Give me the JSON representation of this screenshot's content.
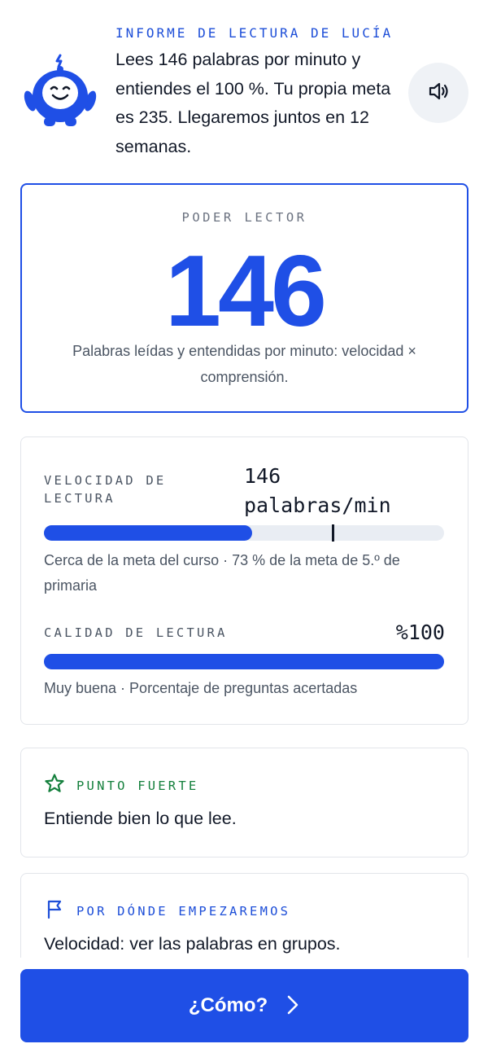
{
  "header": {
    "eyebrow": "INFORME DE LECTURA DE LUCÍA",
    "message": "Lees 146 palabras por minuto y entiendes el 100 %. Tu propia meta es 235. Llegaremos juntos en 12 semanas.",
    "mascot_icon": "robot-mascot-icon",
    "sound_icon": "speaker-icon"
  },
  "power": {
    "label": "PODER LECTOR",
    "value": "146",
    "description": "Palabras leídas y entendidas por minuto: velocidad × comprensión."
  },
  "metrics": {
    "speed": {
      "label": "VELOCIDAD DE LECTURA",
      "value": "146 palabras/min",
      "progress": 0.52,
      "marker": 0.72,
      "note": "Cerca de la meta del curso · 73 % de la meta de 5.º de primaria"
    },
    "quality": {
      "label": "CALIDAD DE LECTURA",
      "value": "%100",
      "progress": 1.0,
      "note": "Muy buena · Porcentaje de preguntas acertadas"
    }
  },
  "strength": {
    "icon": "star-icon",
    "label": "PUNTO FUERTE",
    "text": "Entiende bien lo que lee.",
    "color": "#15803d"
  },
  "start": {
    "icon": "flag-icon",
    "label": "POR DÓNDE EMPEZAREMOS",
    "text": "Velocidad: ver las palabras en grupos.",
    "color": "#1d4ed8"
  },
  "cta": {
    "label": "¿Cómo?",
    "icon": "chevron-right-icon"
  },
  "colors": {
    "accent": "#1f4fe6",
    "track": "#e9edf3",
    "muted_text": "#4b5563"
  }
}
